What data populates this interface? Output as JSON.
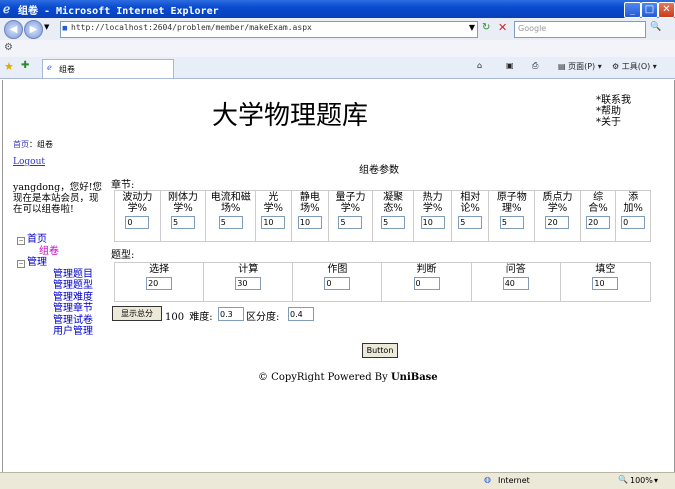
{
  "window": {
    "title": "组卷 - Microsoft Internet Explorer",
    "tab_label": "组卷",
    "address": "http://localhost:2604/problem/member/makeExam.aspx",
    "search_placeholder": "Google",
    "menu_page": "页面(P)",
    "menu_tools": "工具(O)"
  },
  "site": {
    "title": "大学物理题库",
    "links": [
      "*联系我",
      "*帮助",
      "*关于"
    ]
  },
  "nav": {
    "breadcrumb_home": "首页",
    "breadcrumb_sep": "：",
    "breadcrumb_current": "组卷",
    "logout": "Logout",
    "welcome": "yangdong，您好!您现在是本站会员，现在可以组卷啦!",
    "tree": {
      "home": "首页",
      "home_child": "组卷",
      "manage": "管理",
      "manage_items": [
        "管理题目",
        "管理题型",
        "管理难度",
        "管理章节",
        "管理试卷",
        "用户管理"
      ]
    }
  },
  "form": {
    "title": "组卷参数",
    "chapter_label": "章节:",
    "chapters": [
      {
        "label": "波动力学%",
        "value": "0"
      },
      {
        "label": "刚体力学%",
        "value": "5"
      },
      {
        "label": "电流和磁场%",
        "value": "5"
      },
      {
        "label": "光学%",
        "value": "10"
      },
      {
        "label": "静电场%",
        "value": "10"
      },
      {
        "label": "量子力学%",
        "value": "5"
      },
      {
        "label": "凝聚态%",
        "value": "5"
      },
      {
        "label": "热力学%",
        "value": "10"
      },
      {
        "label": "相对论%",
        "value": "5"
      },
      {
        "label": "原子物理%",
        "value": "5"
      },
      {
        "label": "质点力学%",
        "value": "20"
      },
      {
        "label": "综合%",
        "value": "20"
      },
      {
        "label": "添加%",
        "value": "0"
      }
    ],
    "type_label": "题型:",
    "types": [
      {
        "label": "选择",
        "value": "20"
      },
      {
        "label": "计算",
        "value": "30"
      },
      {
        "label": "作图",
        "value": "0"
      },
      {
        "label": "判断",
        "value": "0"
      },
      {
        "label": "问答",
        "value": "40"
      },
      {
        "label": "填空",
        "value": "10"
      }
    ],
    "show_total_button": "显示总分",
    "total": "100",
    "difficulty_label": "难度:",
    "difficulty_value": "0.3",
    "discrimination_label": "区分度:",
    "discrimination_value": "0.4",
    "submit_button": "Button"
  },
  "footer": {
    "copyright": "© CopyRight Powered By ",
    "brand": "UniBase"
  },
  "status": {
    "zone": "Internet",
    "zoom": "100%"
  }
}
